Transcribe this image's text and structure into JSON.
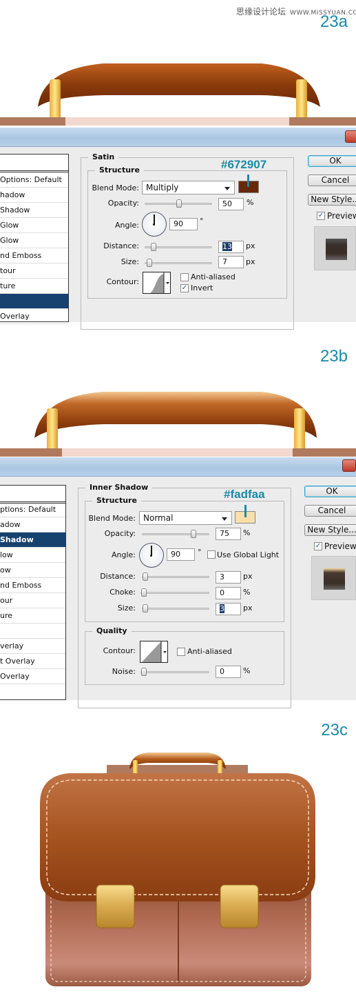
{
  "watermark": {
    "site_cn": "思缘设计论坛",
    "site_url": "WWW.MISSYUAN.COM"
  },
  "steps": [
    "23a",
    "23b",
    "23c"
  ],
  "dialog_a": {
    "layer_list": [
      "",
      "Options: Default",
      "hadow",
      "Shadow",
      "Glow",
      "Glow",
      "nd Emboss",
      "tour",
      "ture",
      "",
      "Overlay"
    ],
    "selected_index": 9,
    "section_title": "Satin",
    "structure_title": "Structure",
    "color_hex": "#672907",
    "color": "#672907",
    "blend_mode_label": "Blend Mode:",
    "blend_mode": "Multiply",
    "opacity_label": "Opacity:",
    "opacity": "50",
    "opacity_unit": "%",
    "angle_label": "Angle:",
    "angle": "90",
    "angle_unit": "°",
    "distance_label": "Distance:",
    "distance": "13",
    "distance_unit": "px",
    "size_label": "Size:",
    "size": "7",
    "size_unit": "px",
    "contour_label": "Contour:",
    "anti_aliased_label": "Anti-aliased",
    "anti_aliased": false,
    "invert_label": "Invert",
    "invert": true,
    "ok": "OK",
    "cancel": "Cancel",
    "new_style": "New Style...",
    "preview_label": "Preview",
    "preview": true
  },
  "dialog_b": {
    "layer_list": [
      "",
      "ptions: Default",
      "adow",
      "Shadow",
      "low",
      "ow",
      "nd Emboss",
      "our",
      "ure",
      "",
      "verlay",
      "t Overlay",
      "Overlay"
    ],
    "selected_index": 3,
    "section_title": "Inner Shadow",
    "structure_title": "Structure",
    "quality_title": "Quality",
    "color_hex": "#fadfaa",
    "color": "#fadfaa",
    "blend_mode_label": "Blend Mode:",
    "blend_mode": "Normal",
    "opacity_label": "Opacity:",
    "opacity": "75",
    "opacity_unit": "%",
    "angle_label": "Angle:",
    "angle": "90",
    "angle_unit": "°",
    "global_light_label": "Use Global Light",
    "global_light": false,
    "distance_label": "Distance:",
    "distance": "3",
    "distance_unit": "px",
    "choke_label": "Choke:",
    "choke": "0",
    "choke_unit": "%",
    "size_label": "Size:",
    "size": "3",
    "size_unit": "px",
    "contour_label": "Contour:",
    "anti_aliased_label": "Anti-aliased",
    "anti_aliased": false,
    "noise_label": "Noise:",
    "noise": "0",
    "noise_unit": "%",
    "ok": "OK",
    "cancel": "Cancel",
    "new_style": "New Style...",
    "preview_label": "Preview",
    "preview": true
  }
}
